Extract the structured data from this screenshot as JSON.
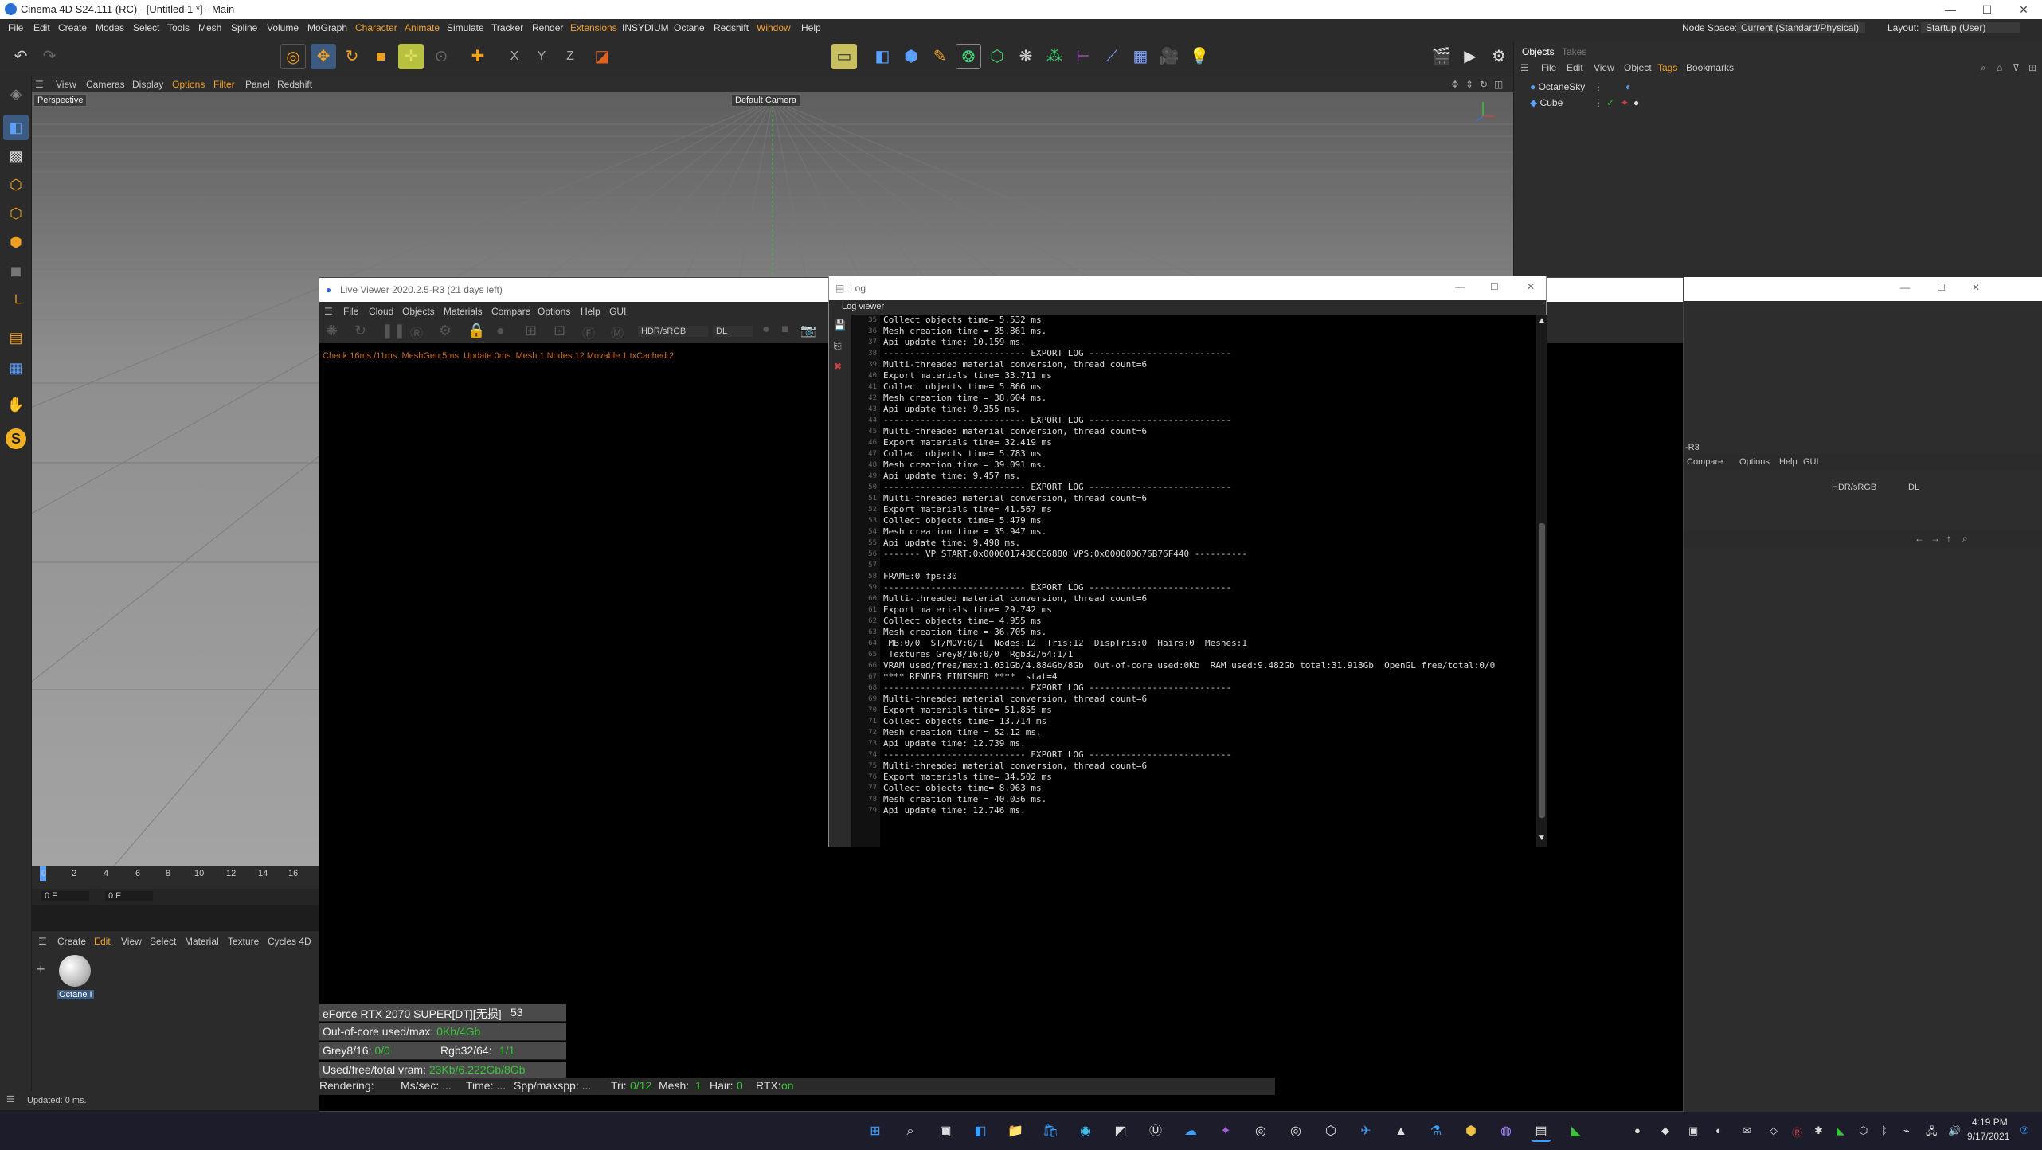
{
  "titlebar": {
    "title": "Cinema 4D S24.111 (RC) - [Untitled 1 *] - Main",
    "minimize": "—",
    "maximize": "☐",
    "close": "✕"
  },
  "menubar": {
    "items": [
      "File",
      "Edit",
      "Create",
      "Modes",
      "Select",
      "Tools",
      "Mesh",
      "Spline",
      "Volume",
      "MoGraph",
      "Character",
      "Animate",
      "Simulate",
      "Tracker",
      "Render",
      "Extensions",
      "INSYDIUM",
      "Octane",
      "Redshift",
      "Window",
      "Help"
    ],
    "node_space_label": "Node Space:",
    "node_space_value": "Current (Standard/Physical)",
    "layout_label": "Layout:",
    "layout_value": "Startup (User)"
  },
  "viewport": {
    "menu": [
      "View",
      "Cameras",
      "Display",
      "Options",
      "Filter",
      "Panel",
      "Redshift"
    ],
    "label": "Perspective",
    "camera": "Default Camera"
  },
  "timeline": {
    "ticks": [
      "0",
      "2",
      "4",
      "6",
      "8",
      "10",
      "12",
      "14",
      "16"
    ],
    "frame_a": "0 F",
    "frame_b": "0 F"
  },
  "material_manager": {
    "menu": [
      "Create",
      "Edit",
      "View",
      "Select",
      "Material",
      "Texture",
      "Cycles 4D"
    ],
    "material_name": "Octane I"
  },
  "statusbar": {
    "text": "Updated: 0 ms."
  },
  "objects_panel": {
    "tabs": [
      "Objects",
      "Takes"
    ],
    "menu": [
      "File",
      "Edit",
      "View",
      "Object",
      "Tags",
      "Bookmarks"
    ],
    "rows": [
      "OctaneSky",
      "Cube"
    ]
  },
  "live_viewer": {
    "title": "Live Viewer 2020.2.5-R3 (21 days left)",
    "menu": [
      "File",
      "Cloud",
      "Objects",
      "Materials",
      "Compare",
      "Options",
      "Help",
      "GUI"
    ],
    "hdr": "HDR/sRGB",
    "dl": "DL",
    "info": "Check:16ms./11ms. MeshGen:5ms. Update:0ms. Mesh:1 Nodes:12 Movable:1 txCached:2",
    "gpu": "eForce RTX 2070 SUPER[DT][无损]",
    "gpu_val": "53",
    "ooc_label": "Out-of-core used/max:",
    "ooc_val": "0Kb/4Gb",
    "grey_label": "Grey8/16:",
    "grey_val": "0/0",
    "rgb_label": "Rgb32/64:",
    "rgb_val": "1/1",
    "vram_label": "Used/free/total vram:",
    "vram_val": "23Kb/6.222Gb/8Gb",
    "render_rendering": "Rendering:",
    "render_ms": "Ms/sec: ...",
    "render_time": "Time: ...",
    "render_spp": "Spp/maxspp: ...",
    "render_tri_label": "Tri:",
    "render_tri": "0/12",
    "render_mesh_label": "Mesh:",
    "render_mesh": "1",
    "render_hair_label": "Hair:",
    "render_hair": "0",
    "render_rtx_label": "RTX:",
    "render_rtx": "on"
  },
  "ghost_panel": {
    "title_frag": "-R3",
    "menu": [
      "Compare",
      "Options",
      "Help",
      "GUI"
    ],
    "hdr": "HDR/sRGB",
    "dl": "DL"
  },
  "log": {
    "title": "Log",
    "subtitle": "Log viewer",
    "line_numbers": [
      "35",
      "36",
      "37",
      "38",
      "39",
      "40",
      "41",
      "42",
      "43",
      "44",
      "45",
      "46",
      "47",
      "48",
      "49",
      "50",
      "51",
      "52",
      "53",
      "54",
      "55",
      "56",
      "57",
      "58",
      "59",
      "60",
      "61",
      "62",
      "63",
      "64",
      "65",
      "66",
      "67",
      "68",
      "69",
      "70",
      "71",
      "72",
      "73",
      "74",
      "75",
      "76",
      "77",
      "78",
      "79"
    ],
    "lines": [
      "Collect objects time= 5.532 ms",
      "Mesh creation time = 35.861 ms.",
      "Api update time: 10.159 ms.",
      "--------------------------- EXPORT LOG ---------------------------",
      "Multi-threaded material conversion, thread count=6",
      "Export materials time= 33.711 ms",
      "Collect objects time= 5.866 ms",
      "Mesh creation time = 38.604 ms.",
      "Api update time: 9.355 ms.",
      "--------------------------- EXPORT LOG ---------------------------",
      "Multi-threaded material conversion, thread count=6",
      "Export materials time= 32.419 ms",
      "Collect objects time= 5.783 ms",
      "Mesh creation time = 39.091 ms.",
      "Api update time: 9.457 ms.",
      "--------------------------- EXPORT LOG ---------------------------",
      "Multi-threaded material conversion, thread count=6",
      "Export materials time= 41.567 ms",
      "Collect objects time= 5.479 ms",
      "Mesh creation time = 35.947 ms.",
      "Api update time: 9.498 ms.",
      "------- VP START:0x0000017488CE6880 VPS:0x000000676B76F440 ----------",
      "",
      "FRAME:0 fps:30",
      "--------------------------- EXPORT LOG ---------------------------",
      "Multi-threaded material conversion, thread count=6",
      "Export materials time= 29.742 ms",
      "Collect objects time= 4.955 ms",
      "Mesh creation time = 36.705 ms.",
      " MB:0/0  ST/MOV:0/1  Nodes:12  Tris:12  DispTris:0  Hairs:0  Meshes:1",
      " Textures Grey8/16:0/0  Rgb32/64:1/1",
      "VRAM used/free/max:1.031Gb/4.884Gb/8Gb  Out-of-core used:0Kb  RAM used:9.482Gb total:31.918Gb  OpenGL free/total:0/0",
      "**** RENDER FINISHED ****  stat=4",
      "--------------------------- EXPORT LOG ---------------------------",
      "Multi-threaded material conversion, thread count=6",
      "Export materials time= 51.855 ms",
      "Collect objects time= 13.714 ms",
      "Mesh creation time = 52.12 ms.",
      "Api update time: 12.739 ms.",
      "--------------------------- EXPORT LOG ---------------------------",
      "Multi-threaded material conversion, thread count=6",
      "Export materials time= 34.502 ms",
      "Collect objects time= 8.963 ms",
      "Mesh creation time = 40.036 ms.",
      "Api update time: 12.746 ms."
    ]
  },
  "taskbar": {
    "time": "4:19 PM",
    "date": "9/17/2021"
  }
}
